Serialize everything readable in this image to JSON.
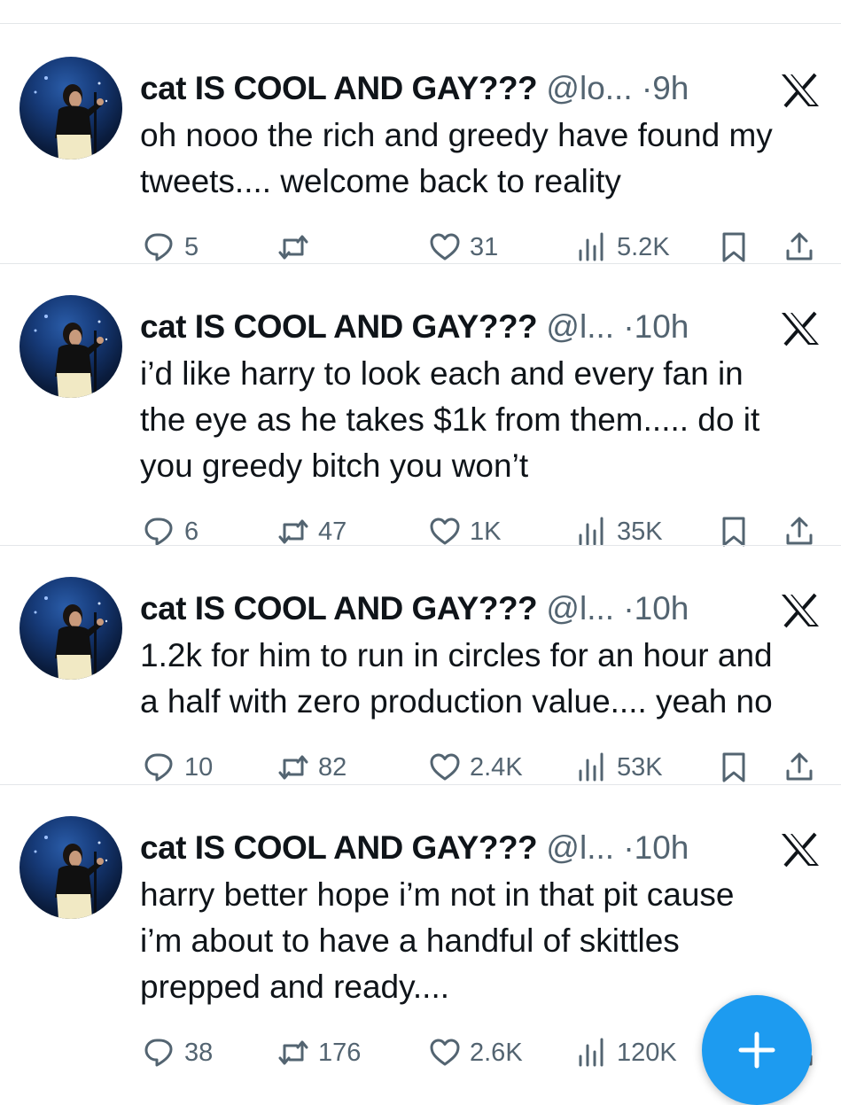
{
  "colors": {
    "text": "#0f1419",
    "secondary": "#536471",
    "accent": "#1d9bf0",
    "divider": "#e3e6e9"
  },
  "tweets": [
    {
      "name": "cat IS COOL AND GAY???",
      "handle": "@lo...",
      "dot": "·",
      "time": "9h",
      "text": [
        "oh nooo the rich and greedy have found my",
        "tweets.... welcome back to reality"
      ],
      "replies": "5",
      "retweets": "",
      "likes": "31",
      "views": "5.2K"
    },
    {
      "name": "cat IS COOL AND GAY???",
      "handle": "@l...",
      "dot": "·",
      "time": "10h",
      "text": [
        "i’d like harry to look each and every fan in",
        "the eye as he takes $1k from them..... do it",
        "you greedy bitch you won’t"
      ],
      "replies": "6",
      "retweets": "47",
      "likes": "1K",
      "views": "35K"
    },
    {
      "name": "cat IS COOL AND GAY???",
      "handle": "@l...",
      "dot": "·",
      "time": "10h",
      "text": [
        "1.2k for him to run in circles for an hour and",
        "a half with zero production value.... yeah no"
      ],
      "replies": "10",
      "retweets": "82",
      "likes": "2.4K",
      "views": "53K"
    },
    {
      "name": "cat IS COOL AND GAY???",
      "handle": "@l...",
      "dot": "·",
      "time": "10h",
      "text": [
        "harry better hope i’m not in that pit cause",
        "i’m about to have a handful of skittles",
        "prepped and ready...."
      ],
      "replies": "38",
      "retweets": "176",
      "likes": "2.6K",
      "views": "120K"
    }
  ],
  "icons": {
    "reply": "reply-icon",
    "retweet": "retweet-icon",
    "like": "heart-icon",
    "views": "views-icon",
    "bookmark": "bookmark-icon",
    "share": "share-icon",
    "platform": "x-logo-icon",
    "compose": "plus-icon"
  }
}
